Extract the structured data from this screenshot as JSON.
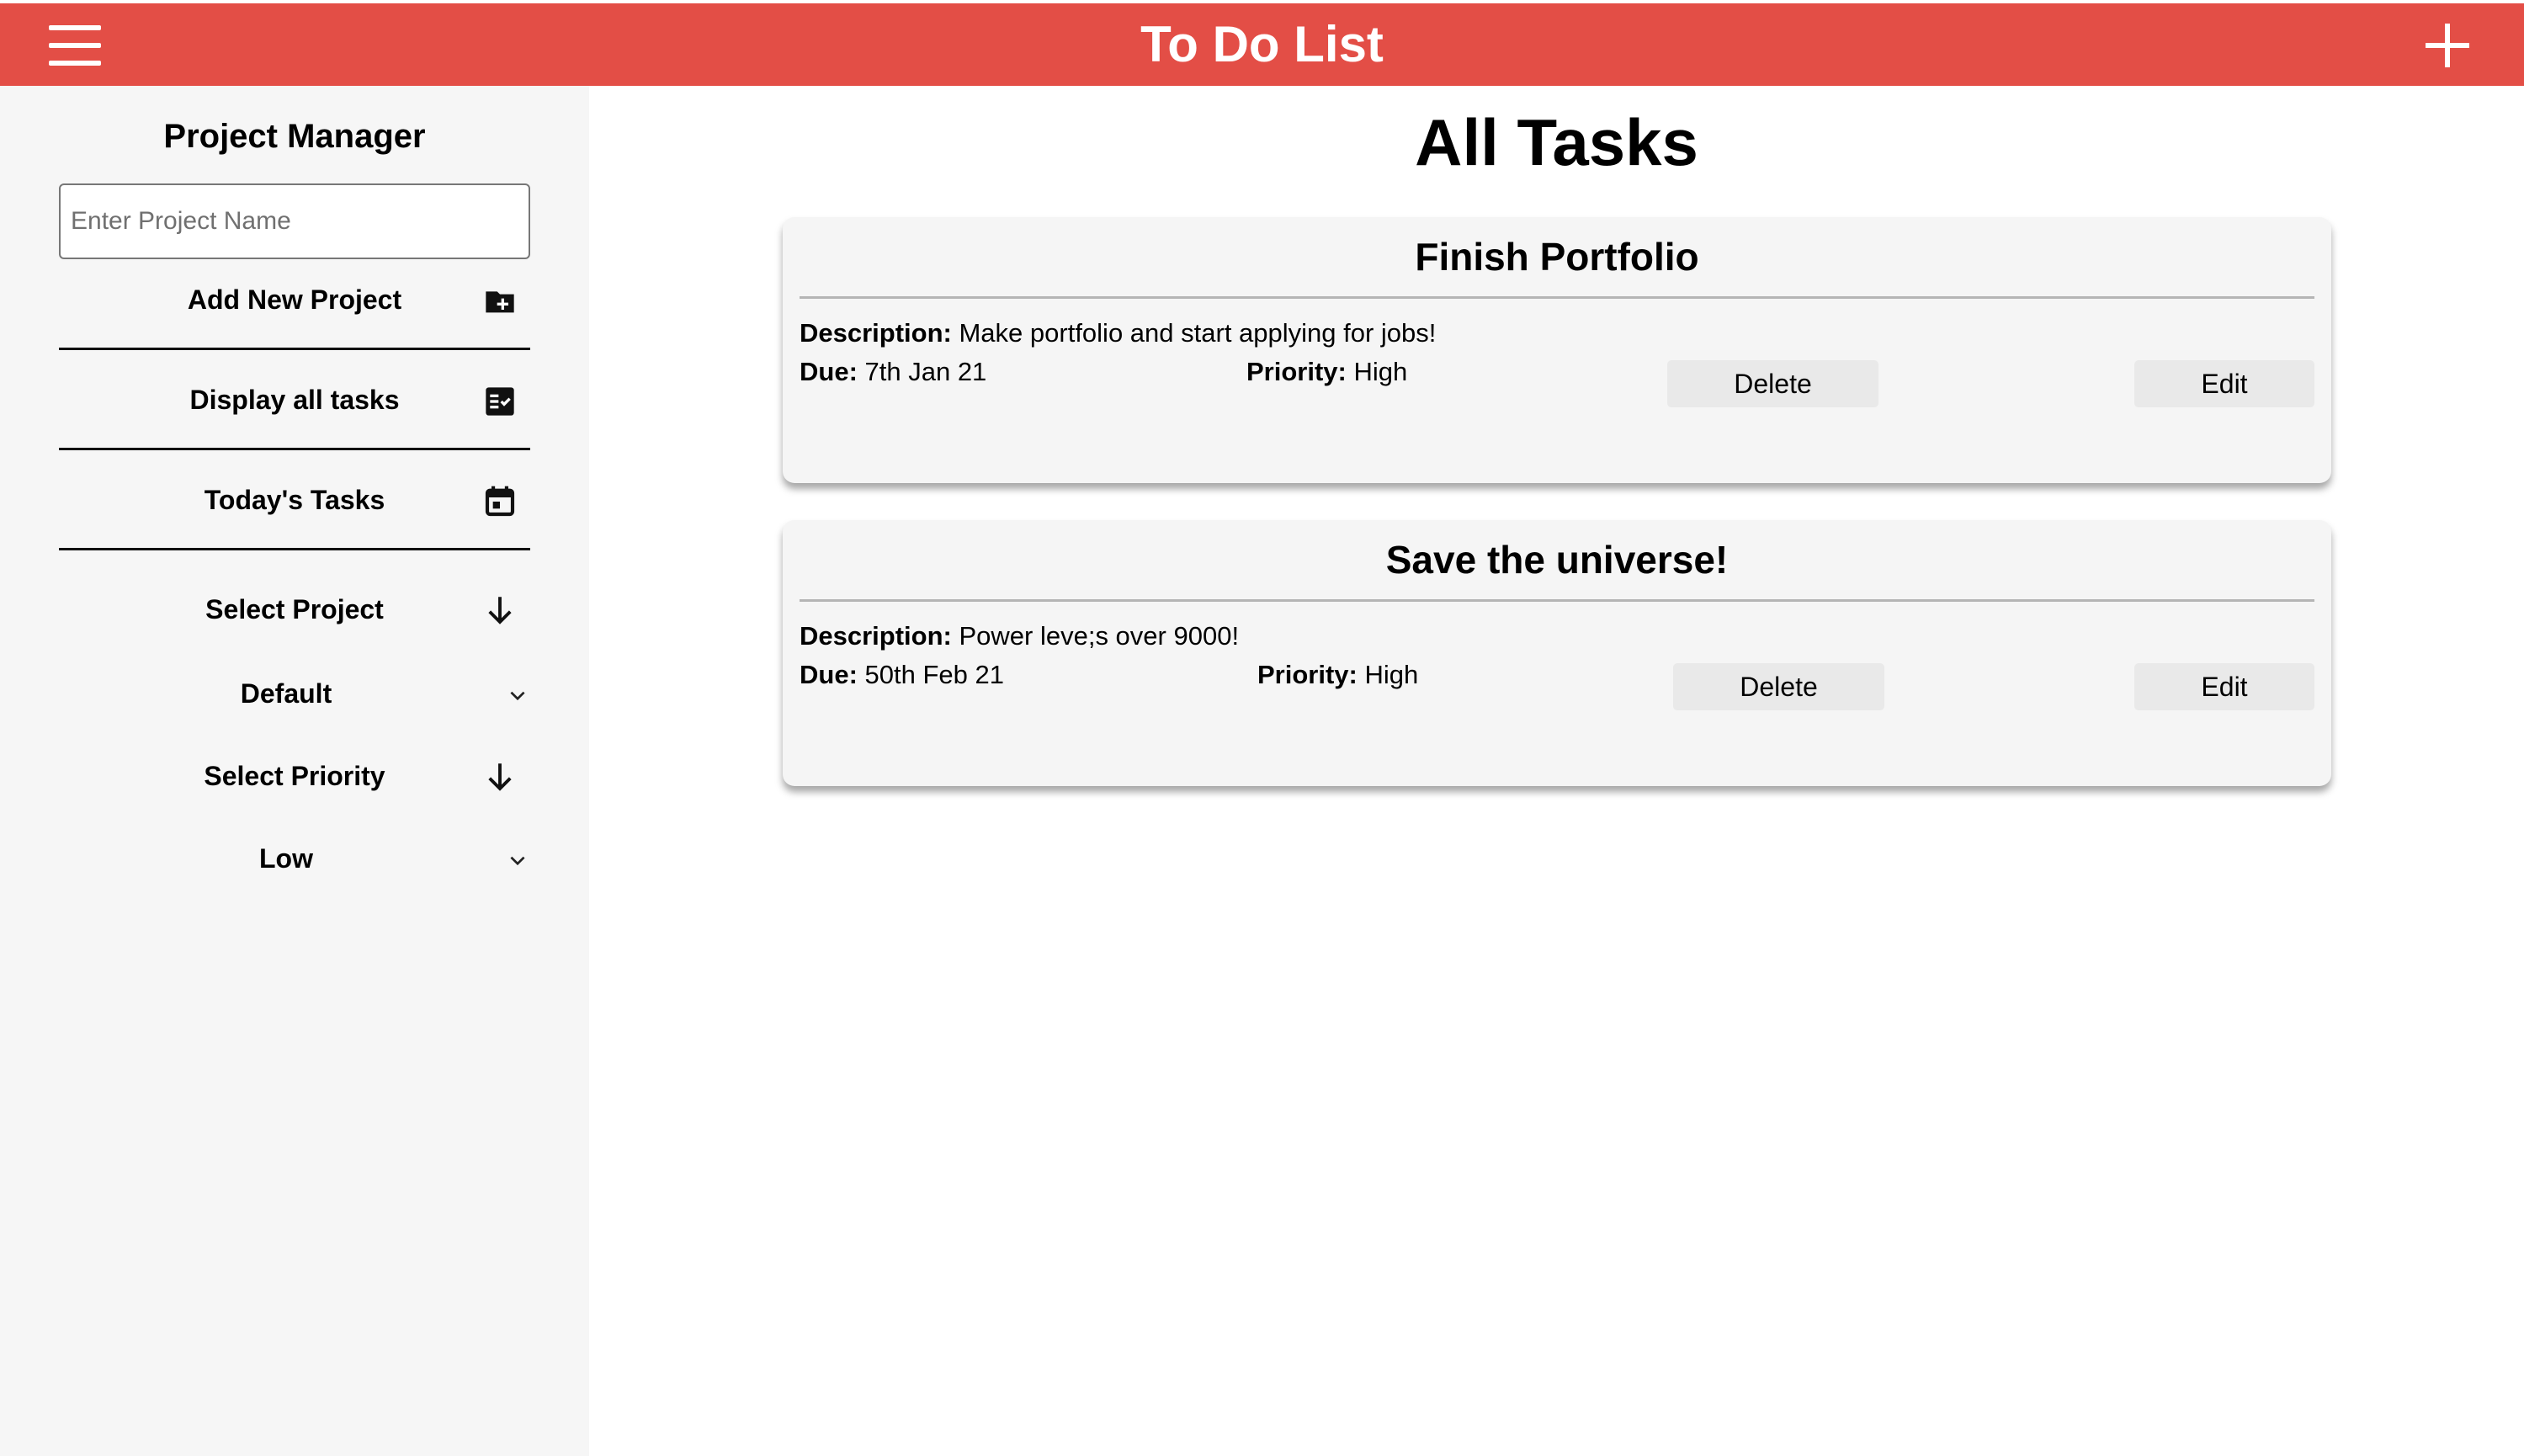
{
  "header": {
    "title": "To Do List",
    "menu_icon": "hamburger-menu-icon",
    "add_icon": "plus-icon"
  },
  "sidebar": {
    "title": "Project Manager",
    "project_input_placeholder": "Enter Project Name",
    "add_project_label": "Add New Project",
    "display_all_label": "Display all tasks",
    "todays_tasks_label": "Today's Tasks",
    "select_project_label": "Select Project",
    "project_selected": "Default",
    "select_priority_label": "Select Priority",
    "priority_selected": "Low"
  },
  "main": {
    "title": "All Tasks",
    "labels": {
      "description": "Description:",
      "due": "Due:",
      "priority": "Priority:"
    },
    "tasks": [
      {
        "title": "Finish Portfolio",
        "description": "Make portfolio and start applying for jobs!",
        "due": "7th Jan 21",
        "priority": "High",
        "delete_label": "Delete",
        "edit_label": "Edit"
      },
      {
        "title": "Save the universe!",
        "description": "Power leve;s over 9000!",
        "due": "50th Feb 21",
        "priority": "High",
        "delete_label": "Delete",
        "edit_label": "Edit"
      }
    ]
  },
  "colors": {
    "header": "#e34e46",
    "sidebar": "#f6f6f6",
    "card": "#f5f5f5",
    "button": "#e9e9e9"
  }
}
